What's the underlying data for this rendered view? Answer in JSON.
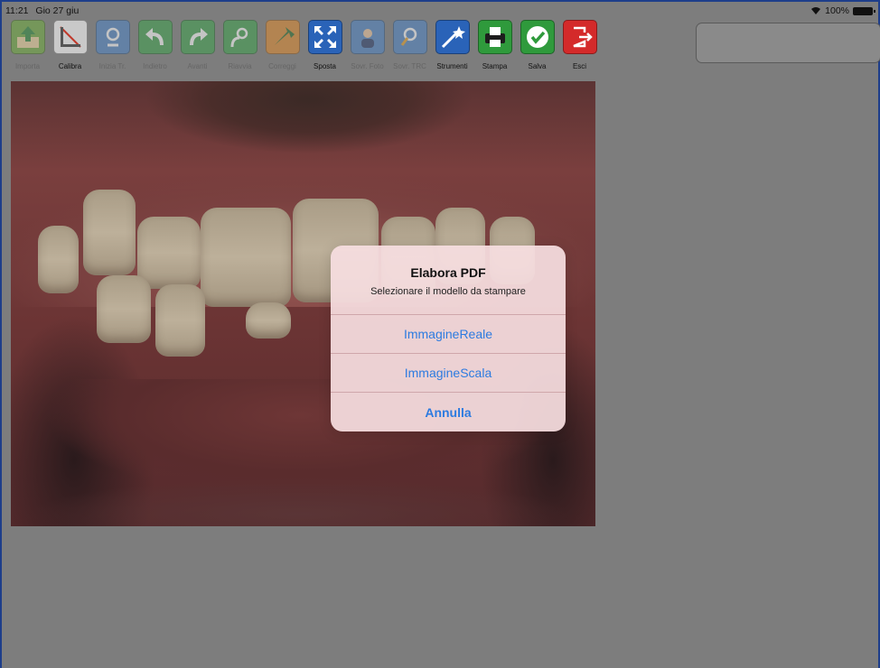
{
  "status_bar": {
    "time": "11:21",
    "date": "Gio 27 giu",
    "battery_percent": "100%"
  },
  "toolbar": {
    "items": [
      {
        "label": "Importa",
        "icon": "import-icon",
        "color": "#6fae3e",
        "enabled": false
      },
      {
        "label": "Calibra",
        "icon": "calibrate-ruler-icon",
        "color": "#c9c9c9",
        "enabled": true
      },
      {
        "label": "Inizia Tr.",
        "icon": "start-trace-icon",
        "color": "#4f86c6",
        "enabled": false
      },
      {
        "label": "Indietro",
        "icon": "undo-arrow-icon",
        "color": "#3fa34d",
        "enabled": false
      },
      {
        "label": "Avanti",
        "icon": "redo-arrow-icon",
        "color": "#3fa34d",
        "enabled": false
      },
      {
        "label": "Riavvia",
        "icon": "restart-icon",
        "color": "#3fa34d",
        "enabled": false
      },
      {
        "label": "Correggi",
        "icon": "correct-cursor-icon",
        "color": "#e08a2e",
        "enabled": false
      },
      {
        "label": "Sposta",
        "icon": "move-arrows-icon",
        "color": "#2a63b8",
        "enabled": true
      },
      {
        "label": "Sovr. Foto",
        "icon": "overlay-photo-icon",
        "color": "#4f86c6",
        "enabled": false
      },
      {
        "label": "Sovr. TRC",
        "icon": "overlay-trace-icon",
        "color": "#4f86c6",
        "enabled": false
      },
      {
        "label": "Strumenti",
        "icon": "magic-wand-icon",
        "color": "#2a63b8",
        "enabled": true
      },
      {
        "label": "Stampa",
        "icon": "printer-icon",
        "color": "#2f9a3c",
        "enabled": true
      },
      {
        "label": "Salva",
        "icon": "checkmark-icon",
        "color": "#2f9a3c",
        "enabled": true
      },
      {
        "label": "Esci",
        "icon": "exit-door-icon",
        "color": "#d42a2a",
        "enabled": true
      }
    ]
  },
  "dialog": {
    "title": "Elabora PDF",
    "message": "Selezionare il modello da stampare",
    "options": [
      "ImmagineReale",
      "ImmagineScala"
    ],
    "cancel_label": "Annulla"
  }
}
